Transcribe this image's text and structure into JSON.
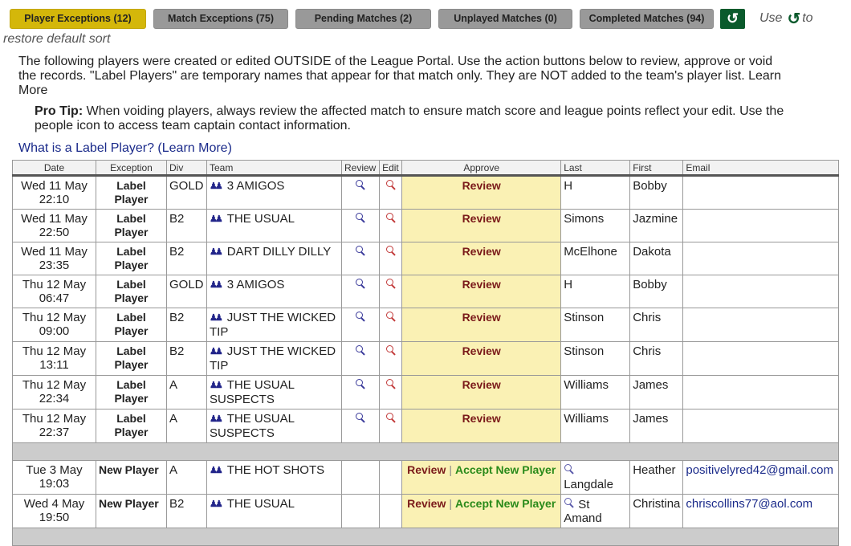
{
  "tabs": [
    {
      "label": "Player Exceptions (12)",
      "active": true
    },
    {
      "label": "Match Exceptions (75)",
      "active": false
    },
    {
      "label": "Pending Matches (2)",
      "active": false
    },
    {
      "label": "Unplayed Matches (0)",
      "active": false
    },
    {
      "label": "Completed Matches (94)",
      "active": false
    }
  ],
  "reset_icon": "↺",
  "hint": {
    "prefix": "Use",
    "glyph": "↺",
    "suffix": "to",
    "line2": "restore default sort"
  },
  "intro": "The following players were created or edited OUTSIDE of the League Portal. Use the action buttons below to review, approve or void the records. \"Label Players\" are temporary names that appear for that match only. They are NOT added to the team's player list. Learn More",
  "protip": {
    "label": "Pro Tip:",
    "text": " When voiding players, always review the affected match to ensure match score and league points reflect your edit. Use the people icon to access team captain contact information."
  },
  "learn_link": "What is a Label Player? (Learn More)",
  "table": {
    "headers": [
      "Date",
      "Exception",
      "Div",
      "Team",
      "Review",
      "Edit",
      "Approve",
      "Last",
      "First",
      "Email"
    ],
    "label_rows": [
      {
        "date": "Wed 11 May",
        "time": "22:10",
        "exception": "Label Player",
        "div": "GOLD",
        "team": "3 AMIGOS",
        "approve": "Review",
        "last": "H",
        "first": "Bobby",
        "email": ""
      },
      {
        "date": "Wed 11 May",
        "time": "22:50",
        "exception": "Label Player",
        "div": "B2",
        "team": "THE USUAL",
        "approve": "Review",
        "last": "Simons",
        "first": "Jazmine",
        "email": ""
      },
      {
        "date": "Wed 11 May",
        "time": "23:35",
        "exception": "Label Player",
        "div": "B2",
        "team": "DART DILLY DILLY",
        "approve": "Review",
        "last": "McElhone",
        "first": "Dakota",
        "email": ""
      },
      {
        "date": "Thu 12 May",
        "time": "06:47",
        "exception": "Label Player",
        "div": "GOLD",
        "team": "3 AMIGOS",
        "approve": "Review",
        "last": "H",
        "first": "Bobby",
        "email": ""
      },
      {
        "date": "Thu 12 May",
        "time": "09:00",
        "exception": "Label Player",
        "div": "B2",
        "team": "JUST THE WICKED TIP",
        "approve": "Review",
        "last": "Stinson",
        "first": "Chris",
        "email": ""
      },
      {
        "date": "Thu 12 May",
        "time": "13:11",
        "exception": "Label Player",
        "div": "B2",
        "team": "JUST THE WICKED TIP",
        "approve": "Review",
        "last": "Stinson",
        "first": "Chris",
        "email": ""
      },
      {
        "date": "Thu 12 May",
        "time": "22:34",
        "exception": "Label Player",
        "div": "A",
        "team": "THE USUAL SUSPECTS",
        "approve": "Review",
        "last": "Williams",
        "first": "James",
        "email": ""
      },
      {
        "date": "Thu 12 May",
        "time": "22:37",
        "exception": "Label Player",
        "div": "A",
        "team": "THE USUAL SUSPECTS",
        "approve": "Review",
        "last": "Williams",
        "first": "James",
        "email": ""
      }
    ],
    "new_rows": [
      {
        "date": "Tue 3 May",
        "time": "19:03",
        "exception": "New Player",
        "div": "A",
        "team": "THE HOT SHOTS",
        "review": "Review",
        "sep": "|",
        "accept": "Accept New Player",
        "last": "Langdale",
        "first": "Heather",
        "email": "positivelyred42@gmail.com"
      },
      {
        "date": "Wed 4 May",
        "time": "19:50",
        "exception": "New Player",
        "div": "B2",
        "team": "THE USUAL",
        "review": "Review",
        "sep": "|",
        "accept": "Accept New Player",
        "last": "St Amand",
        "first": "Christina",
        "email": "chriscollins77@aol.com"
      }
    ]
  },
  "colors": {
    "active_tab": "#d4b70a",
    "inactive_tab": "#999999",
    "reset_green": "#0a5a2c",
    "approve_bg": "#faf1b4",
    "review_red": "#7a1a1a",
    "accept_green": "#2a8a1a",
    "link_blue": "#1a2a8a"
  }
}
